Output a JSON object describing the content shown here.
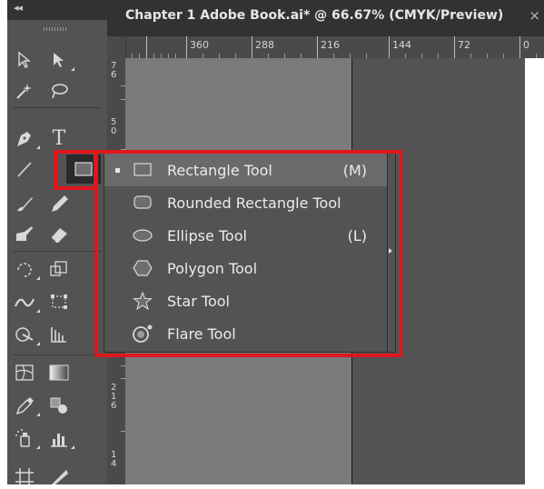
{
  "app": {
    "panel_collapse": "◂◂",
    "document_tab": {
      "title": "Chapter 1 Adobe Book.ai* @ 66.67% (CMYK/Preview)",
      "close": "×"
    }
  },
  "ruler_top": {
    "labels": [
      "360",
      "288",
      "216",
      "144",
      "72",
      "0"
    ]
  },
  "ruler_left": {
    "labels": [
      "76",
      "50",
      "216",
      "14"
    ]
  },
  "tools": [
    {
      "name": "selection-tool",
      "icon": "selection-arrow-icon"
    },
    {
      "name": "direct-selection-tool",
      "icon": "direct-selection-arrow-icon"
    },
    {
      "name": "magic-wand-tool",
      "icon": "magic-wand-icon"
    },
    {
      "name": "lasso-tool",
      "icon": "lasso-icon"
    },
    {
      "name": "pen-tool",
      "icon": "pen-icon"
    },
    {
      "name": "type-tool",
      "icon": "type-icon",
      "glyph": "T"
    },
    {
      "name": "line-segment-tool",
      "icon": "line-segment-icon"
    },
    {
      "name": "rectangle-tool",
      "icon": "rectangle-icon"
    },
    {
      "name": "paintbrush-tool",
      "icon": "paintbrush-icon"
    },
    {
      "name": "pencil-tool",
      "icon": "pencil-icon"
    },
    {
      "name": "blob-brush-tool",
      "icon": "blob-brush-icon"
    },
    {
      "name": "eraser-tool",
      "icon": "eraser-icon"
    },
    {
      "name": "rotate-tool",
      "icon": "rotate-icon"
    },
    {
      "name": "scale-tool",
      "icon": "scale-icon"
    },
    {
      "name": "width-tool",
      "icon": "width-icon"
    },
    {
      "name": "free-transform-tool",
      "icon": "free-transform-icon"
    },
    {
      "name": "shape-builder-tool",
      "icon": "shape-builder-icon"
    },
    {
      "name": "perspective-grid-tool",
      "icon": "perspective-grid-icon"
    },
    {
      "name": "mesh-tool",
      "icon": "mesh-icon"
    },
    {
      "name": "gradient-tool",
      "icon": "gradient-icon"
    },
    {
      "name": "eyedropper-tool",
      "icon": "eyedropper-icon"
    },
    {
      "name": "blend-tool",
      "icon": "blend-icon"
    },
    {
      "name": "symbol-sprayer-tool",
      "icon": "symbol-sprayer-icon"
    },
    {
      "name": "column-graph-tool",
      "icon": "column-graph-icon"
    },
    {
      "name": "artboard-tool",
      "icon": "artboard-icon"
    },
    {
      "name": "slice-tool",
      "icon": "slice-icon"
    }
  ],
  "flyout": {
    "items": [
      {
        "label": "Rectangle Tool",
        "shortcut": "(M)",
        "icon": "rectangle-icon",
        "selected": true
      },
      {
        "label": "Rounded Rectangle Tool",
        "shortcut": "",
        "icon": "rounded-rectangle-icon",
        "selected": false
      },
      {
        "label": "Ellipse Tool",
        "shortcut": "(L)",
        "icon": "ellipse-icon",
        "selected": false
      },
      {
        "label": "Polygon Tool",
        "shortcut": "",
        "icon": "polygon-icon",
        "selected": false
      },
      {
        "label": "Star Tool",
        "shortcut": "",
        "icon": "star-icon",
        "selected": false
      },
      {
        "label": "Flare Tool",
        "shortcut": "",
        "icon": "flare-icon",
        "selected": false
      }
    ]
  },
  "colors": {
    "highlight": "#e0161c",
    "panel": "#535353",
    "tabbar": "#323232",
    "artboard_shade": "#7b7b7b"
  }
}
